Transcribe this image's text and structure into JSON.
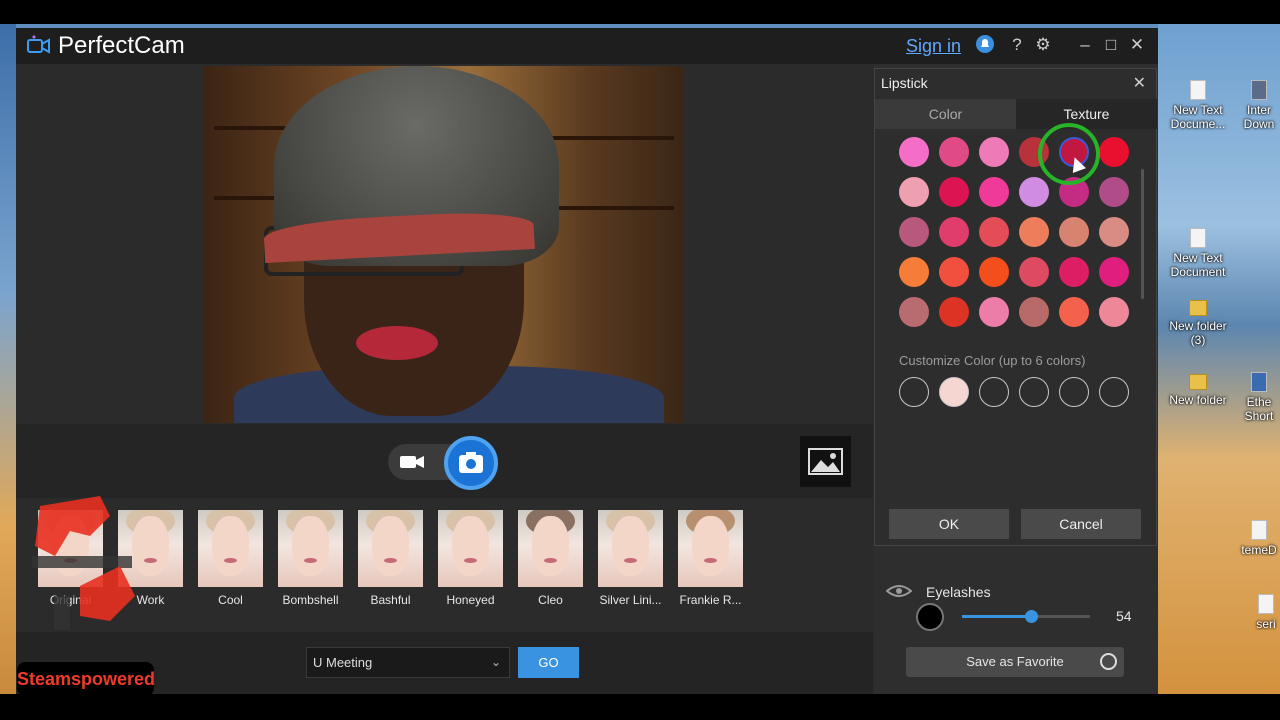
{
  "app": {
    "title": "PerfectCam",
    "sign_in": "Sign in"
  },
  "desktop_icons": [
    {
      "label": "New Text Docume..."
    },
    {
      "label": "Inter Down"
    },
    {
      "label": "New Text Document"
    },
    {
      "label": "New folder (3)"
    },
    {
      "label": "New folder"
    },
    {
      "label": "Ethe Short"
    },
    {
      "label": "temeD"
    },
    {
      "label": "seri"
    }
  ],
  "presets": [
    {
      "label": "Original"
    },
    {
      "label": "Work"
    },
    {
      "label": "Cool"
    },
    {
      "label": "Bombshell"
    },
    {
      "label": "Bashful"
    },
    {
      "label": "Honeyed"
    },
    {
      "label": "Cleo"
    },
    {
      "label": "Silver Lini..."
    },
    {
      "label": "Frankie R..."
    }
  ],
  "scene_select": {
    "value": "U Meeting"
  },
  "go_label": "GO",
  "watermark": "Steamspowered",
  "lipstick": {
    "title": "Lipstick",
    "tabs": [
      "Color",
      "Texture"
    ],
    "active_tab": "Texture",
    "selected_swatch_index": 4,
    "swatches": [
      "#f46ec8",
      "#e04a86",
      "#ee7ab8",
      "#b8323c",
      "#c01840",
      "#e8102e",
      "#eea0b0",
      "#dc1452",
      "#f03a9a",
      "#d08ce0",
      "#c42c84",
      "#b04c88",
      "#b8587c",
      "#e03c6c",
      "#e44c58",
      "#ec7e5c",
      "#d88270",
      "#d88c84",
      "#f67c3a",
      "#f2503e",
      "#f44e1c",
      "#de4a62",
      "#de1e64",
      "#e01e7e",
      "#b86c70",
      "#dc3424",
      "#ec7ca8",
      "#b86a68",
      "#f4624e",
      "#ee8898"
    ],
    "customize_label": "Customize Color (up to 6 colors)",
    "custom_slots": [
      "",
      "#f6d6d0",
      "",
      "",
      "",
      ""
    ],
    "ok": "OK",
    "cancel": "Cancel"
  },
  "eyelashes": {
    "label": "Eyelashes",
    "color": "#000000",
    "value": "54",
    "level": 0.54
  },
  "save_favorite": "Save as Favorite"
}
